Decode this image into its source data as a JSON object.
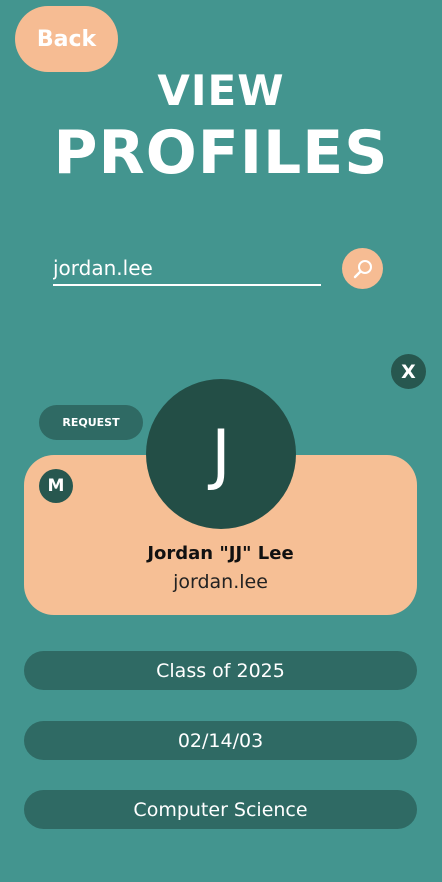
{
  "header": {
    "back_label": "Back",
    "title_line1": "VIEW",
    "title_line2": "PROFILES"
  },
  "search": {
    "value": "jordan.lee",
    "icon": "search-icon"
  },
  "profile": {
    "close_label": "X",
    "request_label": "REQUEST",
    "badge_letter": "M",
    "avatar_initial": "J",
    "name": "Jordan \"JJ\" Lee",
    "username": "jordan.lee"
  },
  "details": {
    "class_year": "Class of 2025",
    "birthdate": "02/14/03",
    "major": "Computer Science"
  },
  "colors": {
    "background": "#43958f",
    "accent_peach": "#f6bc93",
    "dark_teal": "#27574f",
    "pill_teal": "#2f6a64"
  }
}
